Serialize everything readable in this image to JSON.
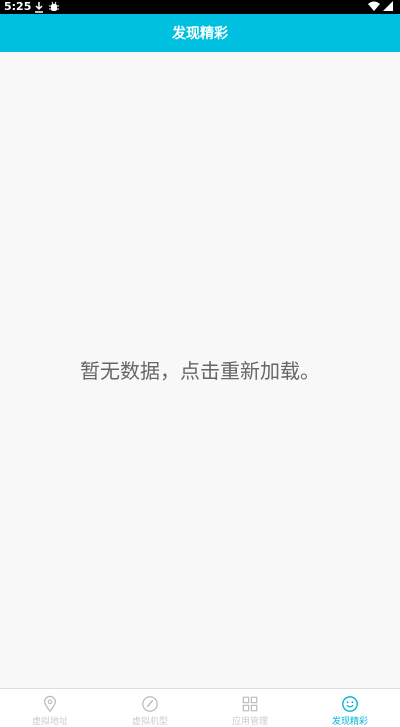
{
  "status_bar": {
    "time": "5:25"
  },
  "header": {
    "title": "发现精彩"
  },
  "content": {
    "empty_message": "暂无数据，点击重新加载。"
  },
  "bottom_nav": [
    {
      "label": "虚拟地址",
      "icon": "location-pin-icon",
      "active": false
    },
    {
      "label": "虚拟机型",
      "icon": "pencil-circle-icon",
      "active": false
    },
    {
      "label": "应用管理",
      "icon": "grid-icon",
      "active": false
    },
    {
      "label": "发现精彩",
      "icon": "smiley-icon",
      "active": true
    }
  ],
  "colors": {
    "accent": "#00c0df",
    "active_tab": "#00b4d8",
    "inactive_tab": "#cccccc"
  }
}
